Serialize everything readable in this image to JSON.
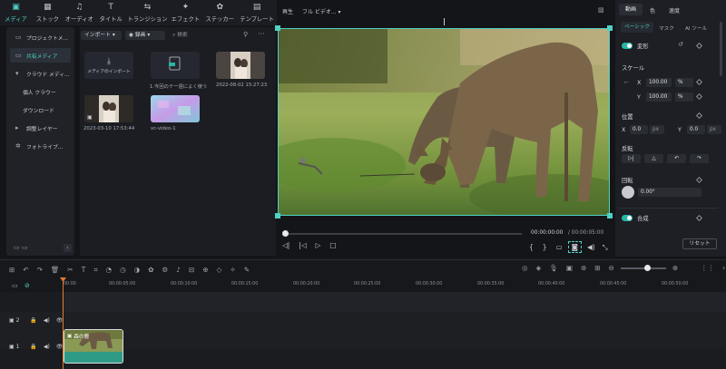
{
  "toolbar": {
    "items": [
      {
        "label": "メディア",
        "icon": "media-icon"
      },
      {
        "label": "ストック",
        "icon": "stock-icon"
      },
      {
        "label": "オーディオ",
        "icon": "audio-icon"
      },
      {
        "label": "タイトル",
        "icon": "title-icon"
      },
      {
        "label": "トランジション",
        "icon": "transition-icon"
      },
      {
        "label": "エフェクト",
        "icon": "effect-icon"
      },
      {
        "label": "ステッカー",
        "icon": "sticker-icon"
      },
      {
        "label": "テンプレート",
        "icon": "template-icon"
      }
    ]
  },
  "sidebar": {
    "items": [
      {
        "label": "プロジェクトメ..."
      },
      {
        "label": "共有メディア"
      },
      {
        "label": "クラウド メディ..."
      },
      {
        "label": "個人 クラウー"
      },
      {
        "label": "ダウンロード"
      },
      {
        "label": "調整レイヤー"
      },
      {
        "label": "フォトライブ..."
      }
    ]
  },
  "media": {
    "import_label": "インポート",
    "record_label": "録画",
    "search_placeholder": "検索",
    "items": [
      {
        "caption": "メディアのインポート",
        "label": "メディアのインポート"
      },
      {
        "caption": "1.今回のテー週によく使う"
      },
      {
        "caption": "2022-08-02 15:27:23"
      },
      {
        "caption": "2023-03-10 17:53:44"
      },
      {
        "caption": "vc-video-1"
      }
    ]
  },
  "preview": {
    "play_label": "再生",
    "quality_label": "フル ビデオ...",
    "time_current": "00:00:00:00",
    "time_total": "/ 00:00:05:00"
  },
  "props": {
    "tabs": [
      "動画",
      "色",
      "速度"
    ],
    "subtabs": [
      "ベーシック",
      "マスク",
      "AI ツール"
    ],
    "transform_label": "変形",
    "scale_label": "スケール",
    "scale_x": "100.00",
    "scale_y": "100.00",
    "percent": "%",
    "position_label": "位置",
    "pos_x": "0.0",
    "pos_y": "0.0",
    "px": "px",
    "flip_label": "反転",
    "rotate_label": "回転",
    "rotate_value": "0.00°",
    "composite_label": "合成",
    "reset_label": "リセット",
    "x": "X",
    "y": "Y"
  },
  "timeline": {
    "ticks": [
      "00:00",
      "00:00:05:00",
      "00:00:10:00",
      "00:00:15:00",
      "00:00:20:00",
      "00:00:25:00",
      "00:00:30:00",
      "00:00:35:00",
      "00:00:40:00",
      "00:00:45:00",
      "00:00:50:00"
    ],
    "track2": "2",
    "track1": "1",
    "clip_label": "森の鹿"
  },
  "colors": {
    "accent": "#4fd1c5",
    "active_toggle": "#26b8a4",
    "clip_bg": "#2f9a86"
  }
}
